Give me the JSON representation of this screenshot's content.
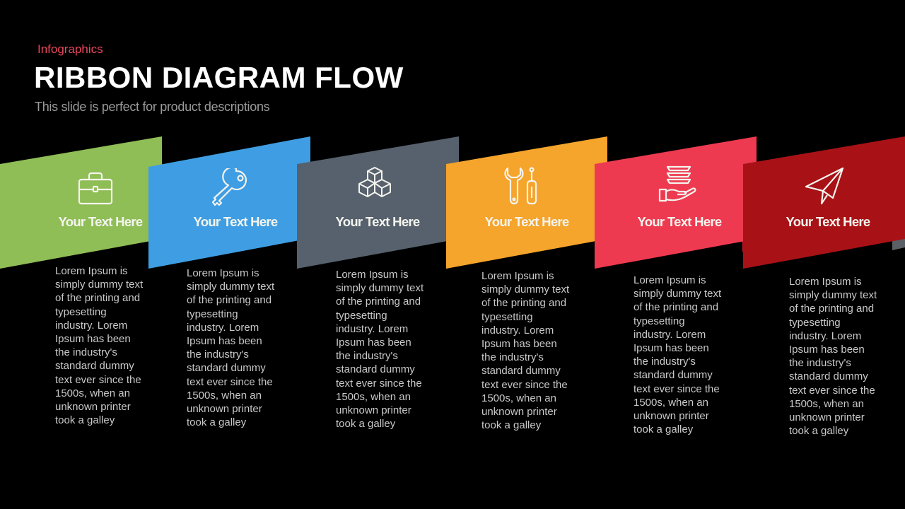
{
  "header": {
    "kicker": "Infographics",
    "title": "RIBBON DIAGRAM FLOW",
    "subtitle": "This slide is perfect for product descriptions"
  },
  "ribbons": [
    {
      "heading": "Your Text Here",
      "icon": "briefcase-icon",
      "color": "#8fbd56",
      "fold_color": "#6e9640",
      "body": "Lorem Ipsum is simply dummy text of the printing and typesetting industry. Lorem Ipsum has been the industry's standard dummy text ever since the 1500s, when an unknown printer took a galley"
    },
    {
      "heading": "Your Text Here",
      "icon": "key-icon",
      "color": "#3f9ee3",
      "fold_color": "#2a7cc0",
      "body": "Lorem Ipsum is simply dummy text of the printing and typesetting industry. Lorem Ipsum has been the industry's standard dummy text ever since the 1500s, when an unknown printer took a galley"
    },
    {
      "heading": "Your Text Here",
      "icon": "cubes-icon",
      "color": "#56616d",
      "fold_color": "#3f4852",
      "body": "Lorem Ipsum is simply dummy text of the printing and typesetting industry. Lorem Ipsum has been the industry's standard dummy text ever since the 1500s, when an unknown printer took a galley"
    },
    {
      "heading": "Your Text Here",
      "icon": "tools-icon",
      "color": "#f5a42c",
      "fold_color": "#c9801a",
      "body": "Lorem Ipsum is simply dummy text of the printing and typesetting industry. Lorem Ipsum has been the industry's standard dummy text ever since the 1500s, when an unknown printer took a galley"
    },
    {
      "heading": "Your Text Here",
      "icon": "hand-layers-icon",
      "color": "#ee3a50",
      "fold_color": "#c4172a",
      "body": "Lorem Ipsum is simply dummy text of the printing and typesetting industry. Lorem Ipsum has been the industry's standard dummy text ever since the 1500s, when an unknown printer took a galley"
    },
    {
      "heading": "Your Text Here",
      "icon": "paper-plane-icon",
      "color": "#a81216",
      "fold_color": "#5b5f66",
      "body": "Lorem Ipsum is simply dummy text of the printing and typesetting industry. Lorem Ipsum has been the industry's standard dummy text ever since the 1500s, when an unknown printer took a galley"
    }
  ]
}
